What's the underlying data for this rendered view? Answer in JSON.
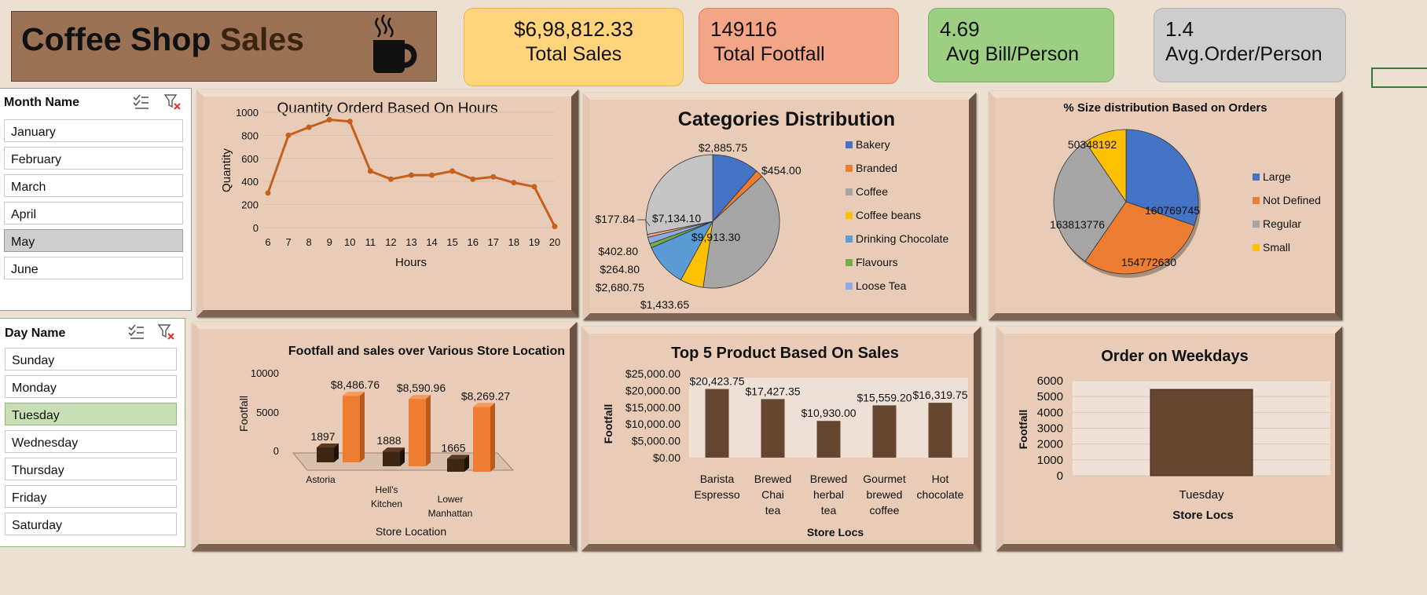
{
  "title": {
    "part1": "Coffee Shop",
    "part2": "Sales"
  },
  "icons": {
    "cup": "coffee-cup-icon",
    "multi_select": "multi-select-icon",
    "clear_filter": "clear-filter-icon"
  },
  "kpis": [
    {
      "value": "$6,98,812.33",
      "label": "Total Sales",
      "color": "#ffd47a"
    },
    {
      "value": "149116",
      "label": "Total Footfall",
      "color": "#f4a587"
    },
    {
      "value": "4.69",
      "label": "Avg Bill/Person",
      "color": "#9ccf82"
    },
    {
      "value": "1.4",
      "label": "Avg.Order/Person",
      "color": "#cdcdcd"
    }
  ],
  "month_slicer": {
    "title": "Month Name",
    "items": [
      "January",
      "February",
      "March",
      "April",
      "May",
      "June"
    ],
    "selected": "May"
  },
  "day_slicer": {
    "title": "Day Name",
    "items": [
      "Sunday",
      "Monday",
      "Tuesday",
      "Wednesday",
      "Thursday",
      "Friday",
      "Saturday"
    ],
    "selected": "Tuesday"
  },
  "chart_data": [
    {
      "type": "line",
      "title": "Quantity Orderd Based On Hours",
      "xlabel": "Hours",
      "ylabel": "Quantity",
      "x": [
        "6",
        "7",
        "8",
        "9",
        "10",
        "11",
        "12",
        "13",
        "14",
        "15",
        "16",
        "17",
        "18",
        "19",
        "20"
      ],
      "y": [
        300,
        800,
        870,
        935,
        920,
        490,
        420,
        455,
        455,
        490,
        420,
        440,
        390,
        355,
        10
      ],
      "ylim": [
        0,
        1000
      ],
      "yticks": [
        "0",
        "200",
        "400",
        "600",
        "800",
        "1000"
      ],
      "color": "#c5601e"
    },
    {
      "type": "pie",
      "title": "Categories Distribution",
      "slices": [
        {
          "name": "Bakery",
          "value": 2885.75,
          "label": "$2,885.75",
          "color": "#4472c4"
        },
        {
          "name": "Branded",
          "value": 454.0,
          "label": "$454.00",
          "color": "#ed7d31"
        },
        {
          "name": "Coffee",
          "value": 9913.3,
          "label": "$9,913.30",
          "color": "#a5a5a5"
        },
        {
          "name": "Coffee beans",
          "value": 1433.65,
          "label": "$1,433.65",
          "color": "#ffc000"
        },
        {
          "name": "Drinking Chocolate",
          "value": 2680.75,
          "label": "$2,680.75",
          "color": "#5b9bd5"
        },
        {
          "name": "Flavours",
          "value": 264.8,
          "label": "$264.80",
          "color": "#70ad47"
        },
        {
          "name": "Loose Tea",
          "value": 402.8,
          "label": "$402.80",
          "color": "#8fa9df"
        },
        {
          "name": "",
          "value": 177.84,
          "label": "$177.84",
          "color": "#f1a984"
        },
        {
          "name": "",
          "value": 7134.1,
          "label": "$7,134.10",
          "color": "#c4c4c4"
        }
      ],
      "legend": [
        "Bakery",
        "Branded",
        "Coffee",
        "Coffee beans",
        "Drinking Chocolate",
        "Flavours",
        "Loose Tea"
      ]
    },
    {
      "type": "pie",
      "title": "% Size distribution Based on Orders",
      "slices": [
        {
          "name": "Large",
          "value": 160769745,
          "label": "160769745",
          "color": "#4472c4"
        },
        {
          "name": "Not Defined",
          "value": 154772630,
          "label": "154772630",
          "color": "#ed7d31"
        },
        {
          "name": "Regular",
          "value": 163813776,
          "label": "163813776",
          "color": "#a5a5a5"
        },
        {
          "name": "Small",
          "value": 50348192,
          "label": "50348192",
          "color": "#ffc000"
        }
      ],
      "legend": [
        "Large",
        "Not Defined",
        "Regular",
        "Small"
      ]
    },
    {
      "type": "bar",
      "title": "Footfall and sales over Various Store Location",
      "xlabel": "Store Location",
      "ylabel": "Footfall",
      "categories": [
        "Astoria",
        "Hell's Kitchen",
        "Lower Manhattan"
      ],
      "series": [
        {
          "name": "Footfall",
          "values": [
            1897,
            1888,
            1665
          ],
          "labels": [
            "1897",
            "1888",
            "1665"
          ],
          "color": "#3d2614"
        },
        {
          "name": "Sales",
          "values": [
            8486.76,
            8590.96,
            8269.27
          ],
          "labels": [
            "$8,486.76",
            "$8,590.96",
            "$8,269.27"
          ],
          "color": "#ee7d31"
        }
      ],
      "ylim": [
        0,
        10000
      ],
      "yticks": [
        "0",
        "5000",
        "10000"
      ]
    },
    {
      "type": "bar",
      "title": "Top 5 Product Based On Sales",
      "xlabel": "Store Locs",
      "ylabel": "Footfall",
      "categories": [
        "Barista Espresso",
        "Brewed Chai tea",
        "Brewed herbal tea",
        "Gourmet brewed coffee",
        "Hot chocolate"
      ],
      "values": [
        20423.75,
        17427.35,
        10930.0,
        15559.2,
        16319.75
      ],
      "labels": [
        "$20,423.75",
        "$17,427.35",
        "$10,930.00",
        "$15,559.20",
        "$16,319.75"
      ],
      "ylim": [
        0,
        25000
      ],
      "yticks": [
        "$0.00",
        "$5,000.00",
        "$10,000.00",
        "$15,000.00",
        "$20,000.00",
        "$25,000.00"
      ],
      "color": "#654631"
    },
    {
      "type": "bar",
      "title": "Order on Weekdays",
      "xlabel": "Store Locs",
      "ylabel": "Footfall",
      "categories": [
        "Tuesday"
      ],
      "values": [
        5450
      ],
      "ylim": [
        0,
        6000
      ],
      "yticks": [
        "0",
        "1000",
        "2000",
        "3000",
        "4000",
        "5000",
        "6000"
      ],
      "color": "#654631"
    }
  ]
}
